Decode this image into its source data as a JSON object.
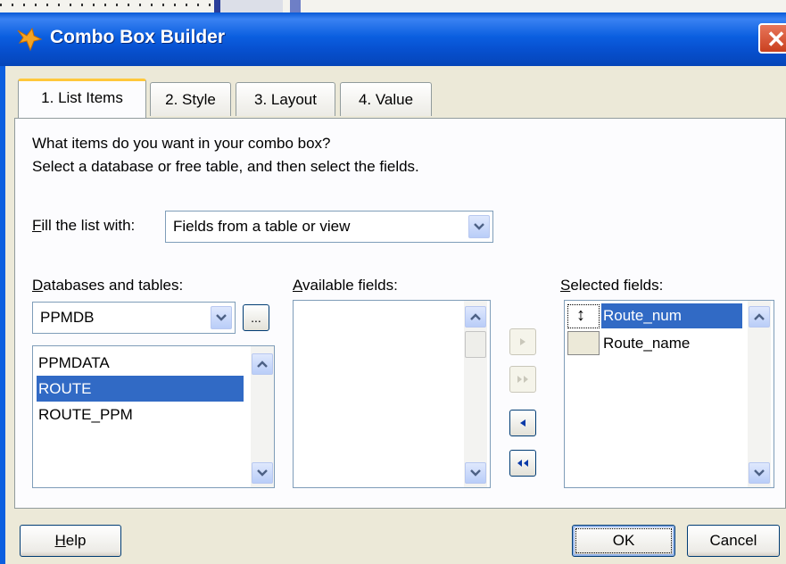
{
  "window": {
    "title": "Combo Box Builder",
    "close_glyph": "✕"
  },
  "tabs": [
    {
      "label": "1. List Items"
    },
    {
      "label": "2. Style"
    },
    {
      "label": "3. Layout"
    },
    {
      "label": "4. Value"
    }
  ],
  "instructions": {
    "line1": "What items do you want in your combo box?",
    "line2": "Select a database or free table, and then select the fields."
  },
  "fill": {
    "label_hotkey": "F",
    "label_rest": "ill the list with:",
    "value": "Fields from a table or view"
  },
  "databases": {
    "label_hotkey": "D",
    "label_rest": "atabases and tables:",
    "selected": "PPMDB",
    "browse_label": "...",
    "items": [
      "PPMDATA",
      "ROUTE",
      "ROUTE_PPM"
    ],
    "selected_item": "ROUTE"
  },
  "available": {
    "label_hotkey": "A",
    "label_rest": "vailable fields:",
    "items": []
  },
  "selected_fields": {
    "label_hotkey": "S",
    "label_rest": "elected fields:",
    "items": [
      "Route_num",
      "Route_name"
    ],
    "selected_item": "Route_num",
    "mover_glyph": "↕"
  },
  "movers": [
    {
      "name": "add",
      "enabled": false
    },
    {
      "name": "add-all",
      "enabled": false
    },
    {
      "name": "remove",
      "enabled": true
    },
    {
      "name": "remove-all",
      "enabled": true
    }
  ],
  "buttons": {
    "help_hotkey": "H",
    "help_rest": "elp",
    "ok": "OK",
    "cancel": "Cancel"
  },
  "colors": {
    "titlebar": "#0b5fe0",
    "selection": "#316ac5",
    "dialog_bg": "#ece9d8",
    "active_tab_accent": "#ffc83c"
  }
}
